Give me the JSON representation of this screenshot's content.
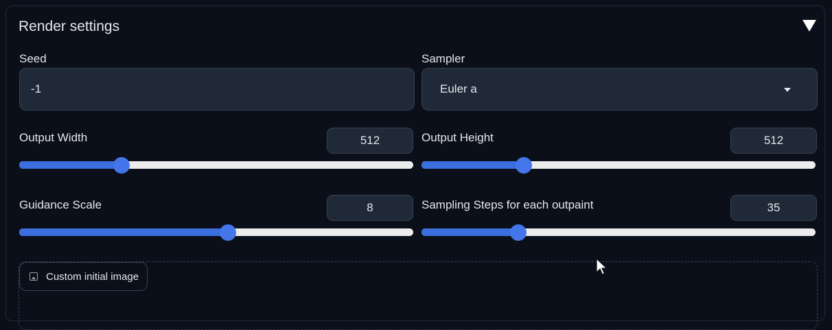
{
  "panel": {
    "title": "Render settings"
  },
  "seed": {
    "label": "Seed",
    "value": "-1"
  },
  "sampler": {
    "label": "Sampler",
    "selected": "Euler a"
  },
  "output_width": {
    "label": "Output Width",
    "value": "512",
    "slider_fraction": 0.26
  },
  "output_height": {
    "label": "Output Height",
    "value": "512",
    "slider_fraction": 0.26
  },
  "guidance_scale": {
    "label": "Guidance Scale",
    "value": "8",
    "slider_fraction": 0.53
  },
  "sampling_steps": {
    "label": "Sampling Steps for each outpaint",
    "value": "35",
    "slider_fraction": 0.245
  },
  "custom_image": {
    "label": "Custom initial image"
  },
  "colors": {
    "background": "#0b0f19",
    "accent": "#3b6fe0",
    "track": "#ececec"
  },
  "icons": {
    "collapse": "triangle-down-icon",
    "dropdown": "caret-down-icon",
    "image": "image-icon",
    "cursor": "mouse-cursor-icon"
  }
}
